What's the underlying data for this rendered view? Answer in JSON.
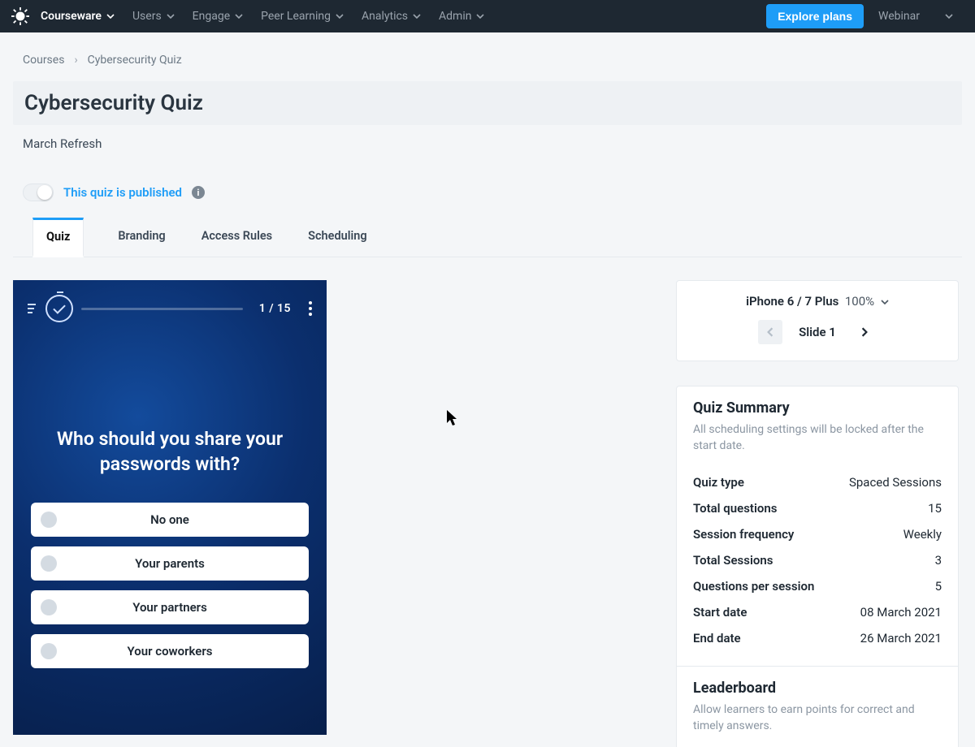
{
  "navbar": {
    "items": [
      {
        "label": "Courseware",
        "active": true
      },
      {
        "label": "Users"
      },
      {
        "label": "Engage"
      },
      {
        "label": "Peer Learning"
      },
      {
        "label": "Analytics"
      },
      {
        "label": "Admin"
      }
    ],
    "explore": "Explore plans",
    "webinar": "Webinar"
  },
  "breadcrumb": {
    "root": "Courses",
    "leaf": "Cybersecurity Quiz"
  },
  "page_title": "Cybersecurity Quiz",
  "subtitle": "March Refresh",
  "publish": {
    "label": "This quiz is published"
  },
  "tabs": [
    "Quiz",
    "Branding",
    "Access Rules",
    "Scheduling"
  ],
  "preview": {
    "counter": "1 / 15",
    "question": "Who should you share your passwords with?",
    "answers": [
      "No one",
      "Your parents",
      "Your partners",
      "Your coworkers"
    ]
  },
  "device": {
    "name": "iPhone 6 / 7 Plus",
    "zoom": "100%",
    "slide": "Slide 1"
  },
  "summary": {
    "heading": "Quiz Summary",
    "note": "All scheduling settings will be locked after the start date.",
    "rows": [
      {
        "k": "Quiz type",
        "v": "Spaced Sessions"
      },
      {
        "k": "Total questions",
        "v": "15"
      },
      {
        "k": "Session frequency",
        "v": "Weekly"
      },
      {
        "k": "Total Sessions",
        "v": "3"
      },
      {
        "k": "Questions per session",
        "v": "5"
      },
      {
        "k": "Start date",
        "v": "08 March 2021"
      },
      {
        "k": "End date",
        "v": "26 March 2021"
      }
    ]
  },
  "leaderboard": {
    "heading": "Leaderboard",
    "note": "Allow learners to earn points for correct and timely answers."
  }
}
